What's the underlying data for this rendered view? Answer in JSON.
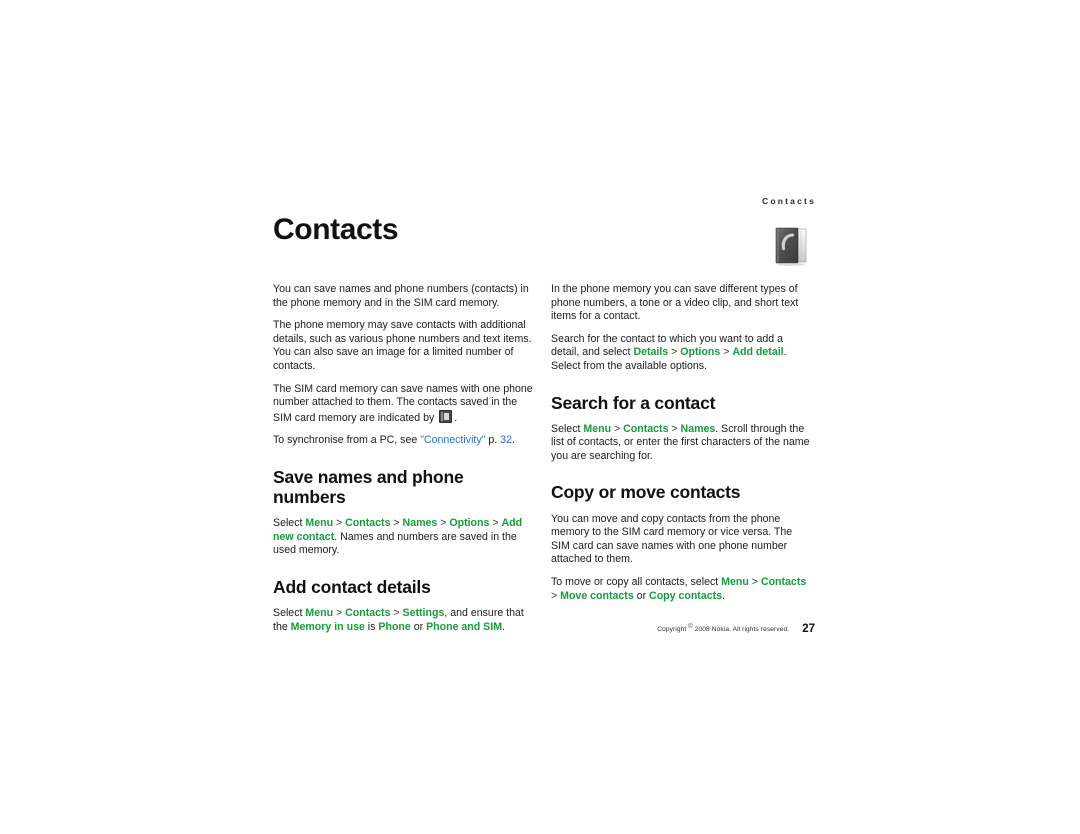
{
  "document": {
    "running_head": "Contacts",
    "chapter_title": "Contacts",
    "chapter_icon": "address-book-icon"
  },
  "left_column": {
    "intro_paragraphs": [
      "You can save names and phone numbers (contacts) in the phone memory and in the SIM card memory.",
      "The phone memory may save contacts with additional details, such as various phone numbers and text items. You can also save an image for a limited number of contacts."
    ],
    "sim_paragraph": {
      "before_icon": "The SIM card memory can save names with one phone number attached to them. The contacts saved in the SIM card memory are indicated by",
      "after_icon": "."
    },
    "sync_paragraph": {
      "lead": "To synchronise from a PC, see ",
      "link": "\"Connectivity\"",
      "mid": " p. ",
      "page_ref": "32",
      "end": "."
    },
    "section_save": {
      "heading": "Save names and phone numbers",
      "lead": "Select ",
      "path": [
        "Menu",
        "Contacts",
        "Names",
        "Options",
        "Add new contact"
      ],
      "tail": ". Names and numbers are saved in the used memory."
    },
    "section_add_details": {
      "heading": "Add contact details",
      "lead": "Select ",
      "path": [
        "Menu",
        "Contacts",
        "Settings"
      ],
      "mid": ", and ensure that the ",
      "setting": "Memory in use",
      "mid2": " is ",
      "option_a": "Phone",
      "or": " or ",
      "option_b": "Phone and SIM",
      "tail": "."
    }
  },
  "right_column": {
    "paragraph_types": "In the phone memory you can save different types of phone numbers, a tone or a video clip, and short text items for a contact.",
    "paragraph_search_detail": {
      "lead": "Search for the contact to which you want to add a detail, and select ",
      "path": [
        "Details",
        "Options",
        "Add detail"
      ],
      "tail": ". Select from the available options."
    },
    "section_search": {
      "heading": "Search for a contact",
      "lead": "Select ",
      "path": [
        "Menu",
        "Contacts",
        "Names"
      ],
      "tail": ". Scroll through the list of contacts, or enter the first characters of the name you are searching for."
    },
    "section_copy_move": {
      "heading": "Copy or move contacts",
      "paragraph": "You can move and copy contacts from the phone memory to the SIM card memory or vice versa. The SIM card can save names with one phone number attached to them.",
      "instruction_lead": "To move or copy all contacts, select ",
      "path": [
        "Menu",
        "Contacts"
      ],
      "action_a": "Move contacts",
      "or": " or ",
      "action_b": "Copy contacts",
      "tail": "."
    }
  },
  "footer": {
    "copyright_pre": "Copyright ",
    "copyright_symbol": "©",
    "copyright_post": " 2008 Nokia. All rights reserved.",
    "page_number": "27"
  },
  "colors": {
    "accent_green": "#179b3b",
    "link_blue": "#2b6fd4",
    "text": "#1c1c1c",
    "background": "#ffffff"
  }
}
